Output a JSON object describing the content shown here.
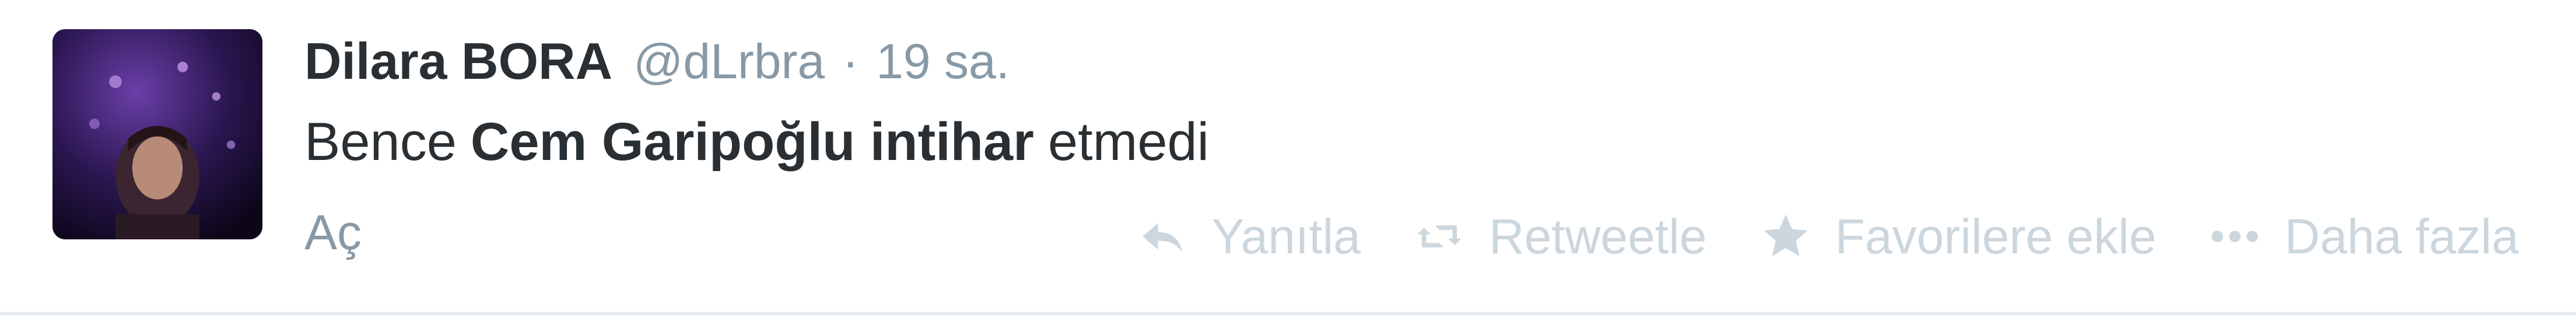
{
  "tweet": {
    "fullname": "Dilara BORA",
    "username": "@dLrbra",
    "separator": "·",
    "time": "19 sa.",
    "text_prefix": "Bence",
    "text_bold": "Cem Garipoğlu intihar",
    "text_suffix": "etmedi",
    "expand_label": "Aç"
  },
  "actions": {
    "reply_label": "Yanıtla",
    "retweet_label": "Retweetle",
    "favorite_label": "Favorilere ekle",
    "more_label": "Daha fazla"
  },
  "icons": {
    "reply": "reply-icon",
    "retweet": "retweet-icon",
    "favorite": "star-icon",
    "more": "more-dots-icon"
  },
  "colors": {
    "name": "#292f33",
    "meta": "#8899a6",
    "action": "#ccd6dd",
    "border": "#e6ecf0"
  }
}
